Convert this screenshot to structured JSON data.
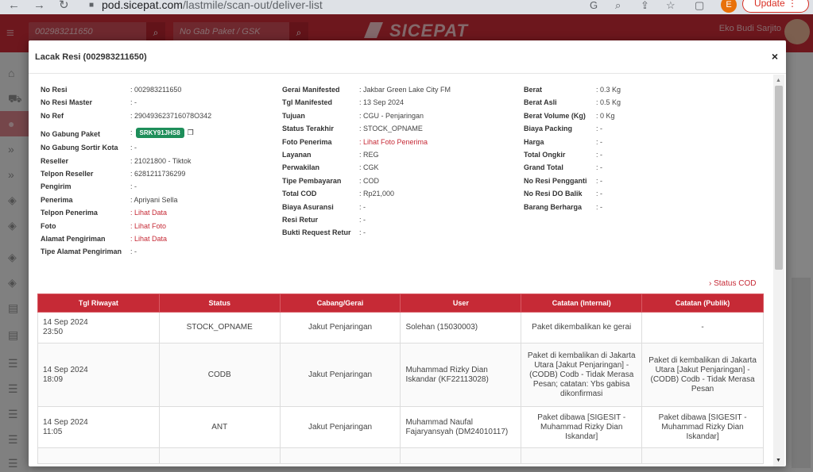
{
  "browser": {
    "url_host": "pod.sicepat.com",
    "url_path": "/lastmile/scan-out/deliver-list",
    "profile_initial": "E",
    "update_label": "Update"
  },
  "header": {
    "search_awb_placeholder": "002983211650",
    "search_gabung_placeholder": "No Gab Paket / GSK",
    "logo_text": "SICEPAT",
    "user_name": "Eko Budi Sarjito"
  },
  "modal": {
    "title": "Lacak Resi (002983211650)",
    "close_label": "×"
  },
  "info": {
    "col1": [
      {
        "label": "No Resi",
        "value": ": 002983211650"
      },
      {
        "label": "No Resi Master",
        "value": ": -"
      },
      {
        "label": "No Ref",
        "value": ": 290493623716078O342"
      },
      {
        "label": "No Gabung Paket",
        "value": ":",
        "badge": "SRKY91JHS8"
      },
      {
        "label": "No Gabung Sortir Kota",
        "value": ": -"
      },
      {
        "label": "Reseller",
        "value": ": 21021800 - Tiktok"
      },
      {
        "label": "Telpon Reseller",
        "value": ": 6281211736299"
      },
      {
        "label": "Pengirim",
        "value": ": -"
      },
      {
        "label": "Penerima",
        "value": ": Apriyani Sella"
      },
      {
        "label": "Telpon Penerima",
        "value": ": Lihat Data",
        "link": true
      },
      {
        "label": "Foto",
        "value": ": Lihat Foto",
        "link": true
      },
      {
        "label": "Alamat Pengiriman",
        "value": ": Lihat Data",
        "link": true
      },
      {
        "label": "Tipe Alamat Pengiriman",
        "value": ": -"
      }
    ],
    "col2": [
      {
        "label": "Gerai Manifested",
        "value": ": Jakbar Green Lake City FM"
      },
      {
        "label": "Tgl Manifested",
        "value": ": 13 Sep 2024"
      },
      {
        "label": "Tujuan",
        "value": ": CGU - Penjaringan"
      },
      {
        "label": "Status Terakhir",
        "value": ": STOCK_OPNAME"
      },
      {
        "label": "Foto Penerima",
        "value": ": Lihat Foto Penerima",
        "link": true
      },
      {
        "label": "Layanan",
        "value": ": REG"
      },
      {
        "label": "Perwakilan",
        "value": ": CGK"
      },
      {
        "label": "Tipe Pembayaran",
        "value": ": COD"
      },
      {
        "label": "Total COD",
        "value": ": Rp21,000"
      },
      {
        "label": "Biaya Asuransi",
        "value": ": -"
      },
      {
        "label": "Resi Retur",
        "value": ": -"
      },
      {
        "label": "Bukti Request Retur",
        "value": ": -"
      }
    ],
    "col3": [
      {
        "label": "Berat",
        "value": ": 0.3 Kg"
      },
      {
        "label": "Berat Asli",
        "value": ": 0.5 Kg"
      },
      {
        "label": "Berat Volume (Kg)",
        "value": ": 0 Kg"
      },
      {
        "label": "Biaya Packing",
        "value": ": -"
      },
      {
        "label": "Harga",
        "value": ": -"
      },
      {
        "label": "Total Ongkir",
        "value": ": -"
      },
      {
        "label": "Grand Total",
        "value": ": -"
      },
      {
        "label": "No Resi Pengganti",
        "value": ": -"
      },
      {
        "label": "No Resi DO Balik",
        "value": ": -"
      },
      {
        "label": "Barang Berharga",
        "value": ": -"
      }
    ]
  },
  "status_cod_link": "› Status COD",
  "history": {
    "headers": [
      "Tgl Riwayat",
      "Status",
      "Cabang/Gerai",
      "User",
      "Catatan (Internal)",
      "Catatan (Publik)"
    ],
    "rows": [
      {
        "date": "14 Sep 2024",
        "time": "23:50",
        "status": "STOCK_OPNAME",
        "branch": "Jakut Penjaringan",
        "user": "Solehan (15030003)",
        "internal": "Paket dikembalikan ke gerai",
        "public": "-"
      },
      {
        "date": "14 Sep 2024",
        "time": "18:09",
        "status": "CODB",
        "branch": "Jakut Penjaringan",
        "user": "Muhammad Rizky Dian Iskandar (KF22113028)",
        "internal": "Paket di kembalikan di Jakarta Utara [Jakut Penjaringan] - (CODB) Codb - Tidak Merasa Pesan; catatan: Ybs gabisa dikonfirmasi",
        "public": "Paket di kembalikan di Jakarta Utara [Jakut Penjaringan] - (CODB) Codb - Tidak Merasa Pesan"
      },
      {
        "date": "14 Sep 2024",
        "time": "11:05",
        "status": "ANT",
        "branch": "Jakut Penjaringan",
        "user": "Muhammad Naufal Fajaryansyah (DM24010117)",
        "internal": "Paket dibawa [SIGESIT - Muhammad Rizky Dian Iskandar]",
        "public": "Paket dibawa [SIGESIT - Muhammad Rizky Dian Iskandar]"
      }
    ]
  },
  "colors": {
    "brand": "#c62a36",
    "badge": "#1e8e5a"
  }
}
